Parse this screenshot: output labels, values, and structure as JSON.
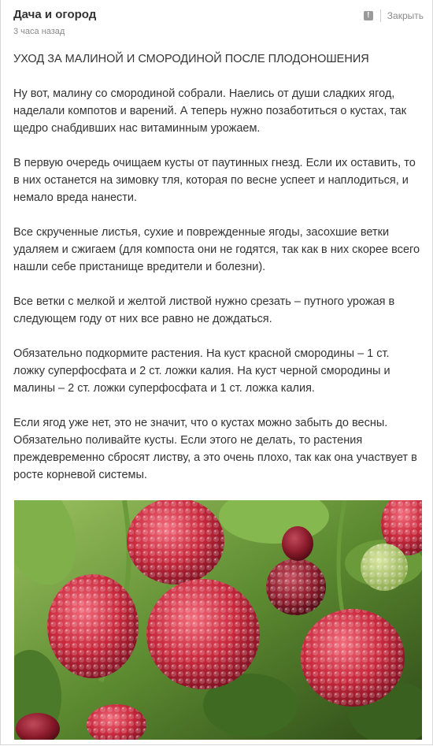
{
  "post": {
    "group_name": "Дача и огород",
    "time": "3 часа назад",
    "close_label": "Закрыть",
    "report_icon": "exclamation-icon",
    "title": "УХОД ЗА МАЛИНОЙ И СМОРОДИНОЙ ПОСЛЕ ПЛОДОНОШЕНИЯ",
    "paragraphs": [
      "Ну вот, малину со смородиной собрали. Наелись от души сладких ягод, наделали компотов и варений. А теперь нужно позаботиться о кустах, так щедро снабдивших нас витаминным урожаем.",
      "В первую очередь очищаем кусты от паутинных гнезд. Если их оставить, то в них останется на зимовку тля, которая по весне успеет и наплодиться, и немало вреда нанести.",
      "Все скрученные листья, сухие и поврежденные ягоды, засохшие ветки удаляем и сжигаем (для компоста они не годятся, так как в них скорее всего нашли себе пристанище вредители и болезни).",
      "Все ветки с мелкой и желтой листвой нужно срезать – путного урожая в следующем году от них все равно не дождаться.",
      "Обязательно подкормите растения. На куст красной смородины – 1 ст. ложку суперфосфата и 2 ст. ложки калия. На куст черной смородины и малины – 2 ст. ложки суперфосфата и 1 ст. ложка калия.",
      "Если ягод уже нет, это не значит, что о кустах можно забыть до весны. Обязательно поливайте кусты. Если этого не делать, то растения преждевременно сбросят листву, а это очень плохо, так как она участвует в росте корневой системы."
    ],
    "image": {
      "subject": "raspberries-photo"
    }
  },
  "colors": {
    "text": "#333333",
    "muted": "#8a8a8a",
    "berry": "#c8283c",
    "leaf": "#5a8a2a"
  }
}
